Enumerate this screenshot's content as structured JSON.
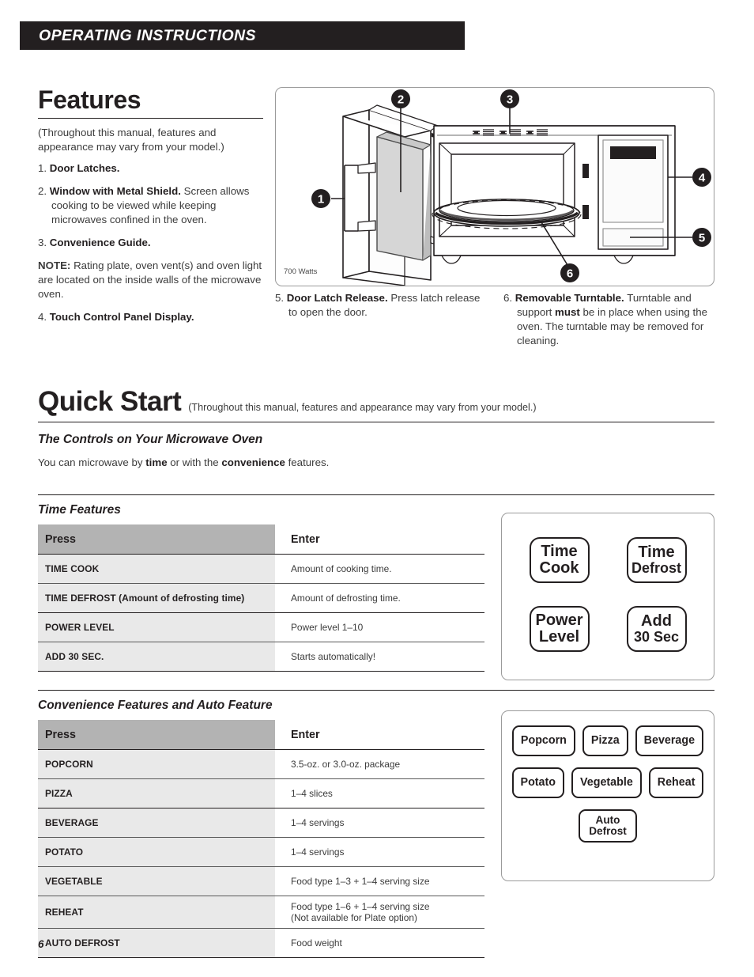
{
  "header": {
    "title": "OPERATING INSTRUCTIONS"
  },
  "features": {
    "title": "Features",
    "intro": "(Throughout this manual, features and appearance may vary from your model.)",
    "items": [
      {
        "num": "1.",
        "bold": "Door Latches.",
        "rest": ""
      },
      {
        "num": "2.",
        "bold": "Window with Metal Shield.",
        "rest": " Screen allows cooking to be viewed while keeping microwaves confined in the oven."
      },
      {
        "num": "3.",
        "bold": "Convenience Guide.",
        "rest": ""
      }
    ],
    "note_label": "NOTE:",
    "note_text": " Rating plate, oven vent(s) and oven light are located on the inside walls of the microwave oven.",
    "item4": {
      "num": "4.",
      "bold": "Touch Control Panel Display.",
      "rest": ""
    },
    "item5": {
      "num": "5.",
      "bold": "Door Latch Release.",
      "rest": " Press latch release to open the door."
    },
    "item6": {
      "num": "6.",
      "bold": "Removable Turntable.",
      "rest_a": " Turntable and support ",
      "bold_b": "must",
      "rest_c": " be in place when using the oven. The turntable may be removed for cleaning."
    }
  },
  "diagram": {
    "watts_label": "700 Watts",
    "callouts": [
      "1",
      "2",
      "3",
      "4",
      "5",
      "6"
    ]
  },
  "quick_start": {
    "title": "Quick Start",
    "subtitle": "(Throughout this manual, features and appearance may vary from your model.)",
    "controls_heading": "The Controls on Your Microwave Oven",
    "body_a": "You can microwave by ",
    "body_bold_a": "time",
    "body_b": " or with the ",
    "body_bold_b": "convenience",
    "body_c": " features."
  },
  "time_features": {
    "heading": "Time Features",
    "columns": [
      "Press",
      "Enter"
    ],
    "rows": [
      {
        "press": "TIME COOK",
        "enter": "Amount of cooking time.",
        "heavy": false
      },
      {
        "press": "TIME DEFROST (Amount of defrosting time)",
        "enter": "Amount of defrosting time.",
        "heavy": true
      },
      {
        "press": "POWER LEVEL",
        "enter": "Power level 1–10",
        "heavy": false
      },
      {
        "press": "ADD 30 SEC.",
        "enter": "Starts automatically!",
        "heavy": false
      }
    ],
    "keypad": [
      [
        {
          "lines": [
            "Time",
            "Cook"
          ],
          "small_second": false
        },
        {
          "lines": [
            "Time",
            "Defrost"
          ],
          "small_second": true
        }
      ],
      [
        {
          "lines": [
            "Power",
            "Level"
          ],
          "small_second": false
        },
        {
          "lines": [
            "Add",
            "30 Sec"
          ],
          "small_second": true
        }
      ]
    ]
  },
  "convenience_features": {
    "heading": "Convenience Features and Auto Feature",
    "columns": [
      "Press",
      "Enter"
    ],
    "rows": [
      {
        "press": "POPCORN",
        "enter": "3.5-oz. or 3.0-oz. package",
        "enter2": "",
        "heavy": false
      },
      {
        "press": "PIZZA",
        "enter": "1–4 slices",
        "enter2": "",
        "heavy": true
      },
      {
        "press": "BEVERAGE",
        "enter": "1–4 servings",
        "enter2": "",
        "heavy": false
      },
      {
        "press": "POTATO",
        "enter": "1–4 servings",
        "enter2": "",
        "heavy": false
      },
      {
        "press": "VEGETABLE",
        "enter": "Food type 1–3 + 1–4 serving size",
        "enter2": "",
        "heavy": false
      },
      {
        "press": "REHEAT",
        "enter": "Food type 1–6 + 1–4 serving size",
        "enter2": "(Not available for Plate option)",
        "heavy": false
      },
      {
        "press": "AUTO DEFROST",
        "enter": "Food weight",
        "enter2": "",
        "heavy": false
      }
    ],
    "keypad": [
      [
        {
          "lines": [
            "Popcorn"
          ]
        },
        {
          "lines": [
            "Pizza"
          ]
        },
        {
          "lines": [
            "Beverage"
          ]
        }
      ],
      [
        {
          "lines": [
            "Potato"
          ]
        },
        {
          "lines": [
            "Vegetable"
          ]
        },
        {
          "lines": [
            "Reheat"
          ]
        }
      ],
      [
        {
          "lines": [
            "Auto",
            "Defrost"
          ]
        }
      ]
    ]
  },
  "footer": {
    "page_number": "6"
  },
  "colors": {
    "ink": "#231f20",
    "header_bar": "#231f20",
    "table_header_gray": "#b3b3b3",
    "table_row_gray": "#e9e9e9",
    "box_border": "#9b9b9b"
  }
}
